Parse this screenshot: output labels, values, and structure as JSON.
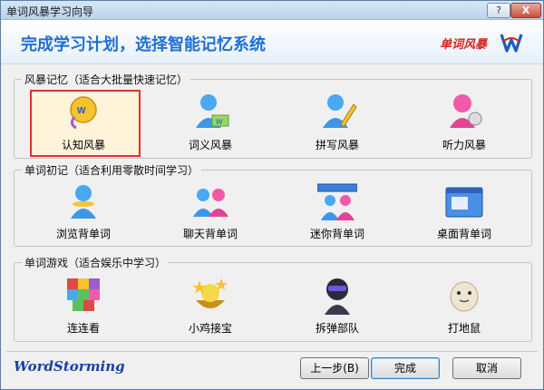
{
  "window": {
    "title": "单词风暴学习向导",
    "help_label": "?",
    "close_label": "X"
  },
  "banner": {
    "title": "完成学习计划，选择智能记忆系统",
    "brand": "单词风暴"
  },
  "groups": {
    "storm": {
      "title": "风暴记忆（适合大批量快速记忆）",
      "items": [
        "认知风暴",
        "词义风暴",
        "拼写风暴",
        "听力风暴"
      ]
    },
    "initial": {
      "title": "单词初记（适合利用零散时间学习）",
      "items": [
        "浏览背单词",
        "聊天背单词",
        "迷你背单词",
        "桌面背单词"
      ]
    },
    "games": {
      "title": "单词游戏（适合娱乐中学习）",
      "items": [
        "连连看",
        "小鸡接宝",
        "拆弹部队",
        "打地鼠"
      ]
    }
  },
  "selected": "认知风暴",
  "footer": {
    "brand": "WordStorming",
    "back_label": "上一步(B)",
    "finish_label": "完成",
    "cancel_label": "取消"
  },
  "colors": {
    "accent": "#1d6fd6",
    "selection_border": "#e03030",
    "brand_red": "#d2231a"
  }
}
